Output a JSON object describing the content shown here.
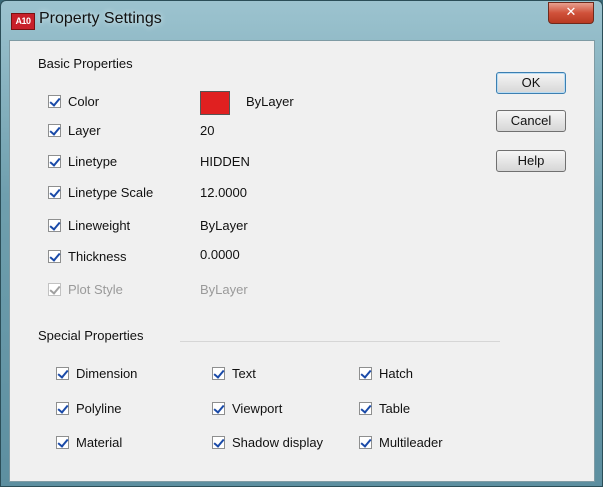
{
  "window": {
    "title": "Property Settings",
    "app_logo_text": "A10",
    "close_glyph": "✕"
  },
  "basic": {
    "label": "Basic Properties",
    "items": [
      {
        "label": "Color",
        "value": "ByLayer",
        "checked": true
      },
      {
        "label": "Layer",
        "value": "20",
        "checked": true
      },
      {
        "label": "Linetype",
        "value": "HIDDEN",
        "checked": true
      },
      {
        "label": "Linetype Scale",
        "value": "12.0000",
        "checked": true
      },
      {
        "label": "Lineweight",
        "value": "ByLayer",
        "checked": true
      },
      {
        "label": "Thickness",
        "value": "0.0000",
        "checked": true
      },
      {
        "label": "Plot Style",
        "value": "ByLayer",
        "checked": true,
        "disabled": true
      }
    ],
    "color_swatch": "#e02020"
  },
  "special": {
    "label": "Special Properties",
    "items": [
      {
        "label": "Dimension",
        "checked": true
      },
      {
        "label": "Text",
        "checked": true
      },
      {
        "label": "Hatch",
        "checked": true
      },
      {
        "label": "Polyline",
        "checked": true
      },
      {
        "label": "Viewport",
        "checked": true
      },
      {
        "label": "Table",
        "checked": true
      },
      {
        "label": "Material",
        "checked": true
      },
      {
        "label": "Shadow display",
        "checked": true
      },
      {
        "label": "Multileader",
        "checked": true
      }
    ]
  },
  "buttons": {
    "ok": "OK",
    "cancel": "Cancel",
    "help": "Help"
  }
}
